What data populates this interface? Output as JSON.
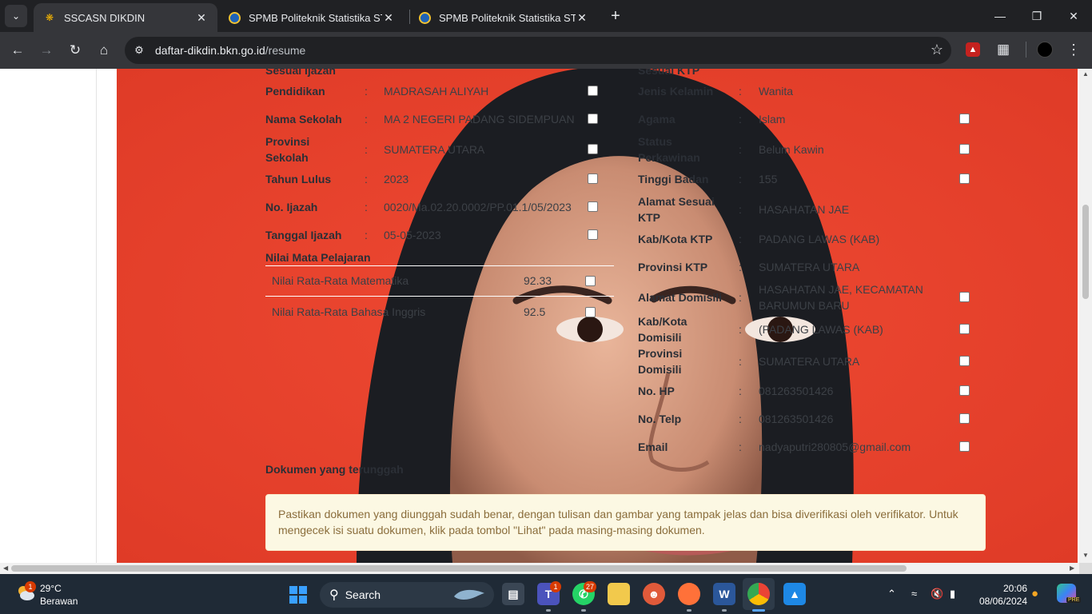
{
  "browser": {
    "tabs": [
      {
        "title": "SSCASN DIKDIN",
        "icon": "sscasn-icon",
        "active": true
      },
      {
        "title": "SPMB Politeknik Statistika STIS",
        "icon": "stis-icon",
        "active": false
      },
      {
        "title": "SPMB Politeknik Statistika STIS",
        "icon": "stis-icon",
        "active": false
      }
    ],
    "url_host": "daftar-dikdin.bkn.go.id",
    "url_path": "/resume"
  },
  "left_column": {
    "partial_top_label": "Sesuai Ijazah",
    "fields": [
      {
        "label": "Pendidikan",
        "value": "MADRASAH ALIYAH"
      },
      {
        "label": "Nama Sekolah",
        "value": "MA 2 NEGERI PADANG SIDEMPUAN"
      },
      {
        "label": "Provinsi Sekolah",
        "value": "SUMATERA UTARA"
      },
      {
        "label": "Tahun Lulus",
        "value": "2023"
      },
      {
        "label": "No. Ijazah",
        "value": "0020/Ma.02.20.0002/PP.01.1/05/2023"
      },
      {
        "label": "Tanggal Ijazah",
        "value": "05-05-2023"
      }
    ],
    "grades_title": "Nilai Mata Pelajaran",
    "grades": [
      {
        "subject": "Nilai Rata-Rata Matematika",
        "value": "92.33"
      },
      {
        "subject": "Nilai Rata-Rata Bahasa Inggris",
        "value": "92.5"
      }
    ]
  },
  "right_column": {
    "partial_top_label": "Sesuai KTP",
    "fields": [
      {
        "label": "Jenis Kelamin",
        "value": "Wanita"
      },
      {
        "label": "Agama",
        "value": "Islam"
      },
      {
        "label": "Status Perkawinan",
        "value": "Belum Kawin"
      },
      {
        "label": "Tinggi Badan",
        "value": "155"
      },
      {
        "label": "Alamat Sesuai KTP",
        "value": "HASAHATAN JAE"
      },
      {
        "label": "Kab/Kota KTP",
        "value": "PADANG LAWAS (KAB)"
      },
      {
        "label": "Provinsi KTP",
        "value": "SUMATERA UTARA"
      },
      {
        "label": "Alamat Domisili",
        "value": "HASAHATAN JAE, KECAMATAN BARUMUN BARU"
      },
      {
        "label": "Kab/Kota Domisili",
        "value": "(PADANG LAWAS (KAB)"
      },
      {
        "label": "Provinsi Domisili",
        "value": "SUMATERA UTARA"
      },
      {
        "label": "No. HP",
        "value": "081263501426"
      },
      {
        "label": "No. Telp",
        "value": "081263501426"
      },
      {
        "label": "Email",
        "value": "nadyaputri280805@gmail.com"
      }
    ]
  },
  "documents": {
    "title": "Dokumen yang terunggah",
    "notice": "Pastikan dokumen yang diunggah sudah benar, dengan tulisan dan gambar yang tampak jelas dan bisa diverifikasi oleh verifikator. Untuk mengecek isi suatu dokumen, klik pada tombol \"Lihat\" pada masing-masing dokumen."
  },
  "taskbar": {
    "weather_temp": "29°C",
    "weather_desc": "Berawan",
    "weather_badge": "1",
    "search_label": "Search",
    "teams_badge": "1",
    "whatsapp_badge": "27",
    "time": "20:06",
    "date": "08/06/2024",
    "copilot_badge": "PRE"
  },
  "colors": {
    "photo_background": "#e8402c",
    "notice_background": "#fcf8e3",
    "notice_text": "#8a6d3b"
  }
}
